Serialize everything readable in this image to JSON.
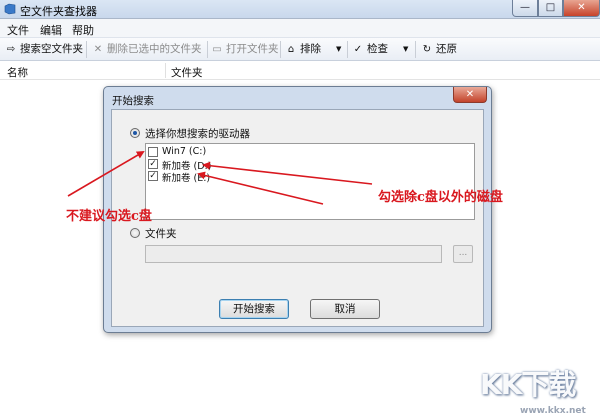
{
  "window": {
    "title": "空文件夹查找器",
    "controls": {
      "minimize": "—",
      "maximize": "□",
      "close": "✕"
    }
  },
  "menu": [
    "文件",
    "编辑",
    "帮助"
  ],
  "toolbar": {
    "search_empty": "搜索空文件夹",
    "delete_selected": "删除已选中的文件夹",
    "open_folder": "打开文件夹",
    "exclude": "排除",
    "check": "检查",
    "restore": "还原",
    "icons": {
      "search_empty": "folder-search-icon",
      "delete_selected": "delete-x-icon",
      "open_folder": "folder-open-icon",
      "exclude": "exclude-filter-icon",
      "check": "checkmark-icon",
      "restore": "restore-arrows-icon"
    }
  },
  "list": {
    "columns": [
      "名称",
      "文件夹"
    ]
  },
  "dialog": {
    "title": "开始搜索",
    "close": "✕",
    "option_drives": "选择你想搜索的驱动器",
    "drives": [
      {
        "label": "Win7 (C:)",
        "checked": false
      },
      {
        "label": "新加卷 (D:)",
        "checked": true
      },
      {
        "label": "新加卷 (E:)",
        "checked": true
      }
    ],
    "option_folder": "文件夹",
    "folder_path": "",
    "browse": "...",
    "start_button": "开始搜索",
    "cancel_button": "取消"
  },
  "annotations": {
    "left": "不建议勾选c盘",
    "right": "勾选除c盘以外的磁盘",
    "color": "#d9181f"
  },
  "watermark": {
    "brand": "KK下载",
    "url": "www.kkx.net"
  }
}
